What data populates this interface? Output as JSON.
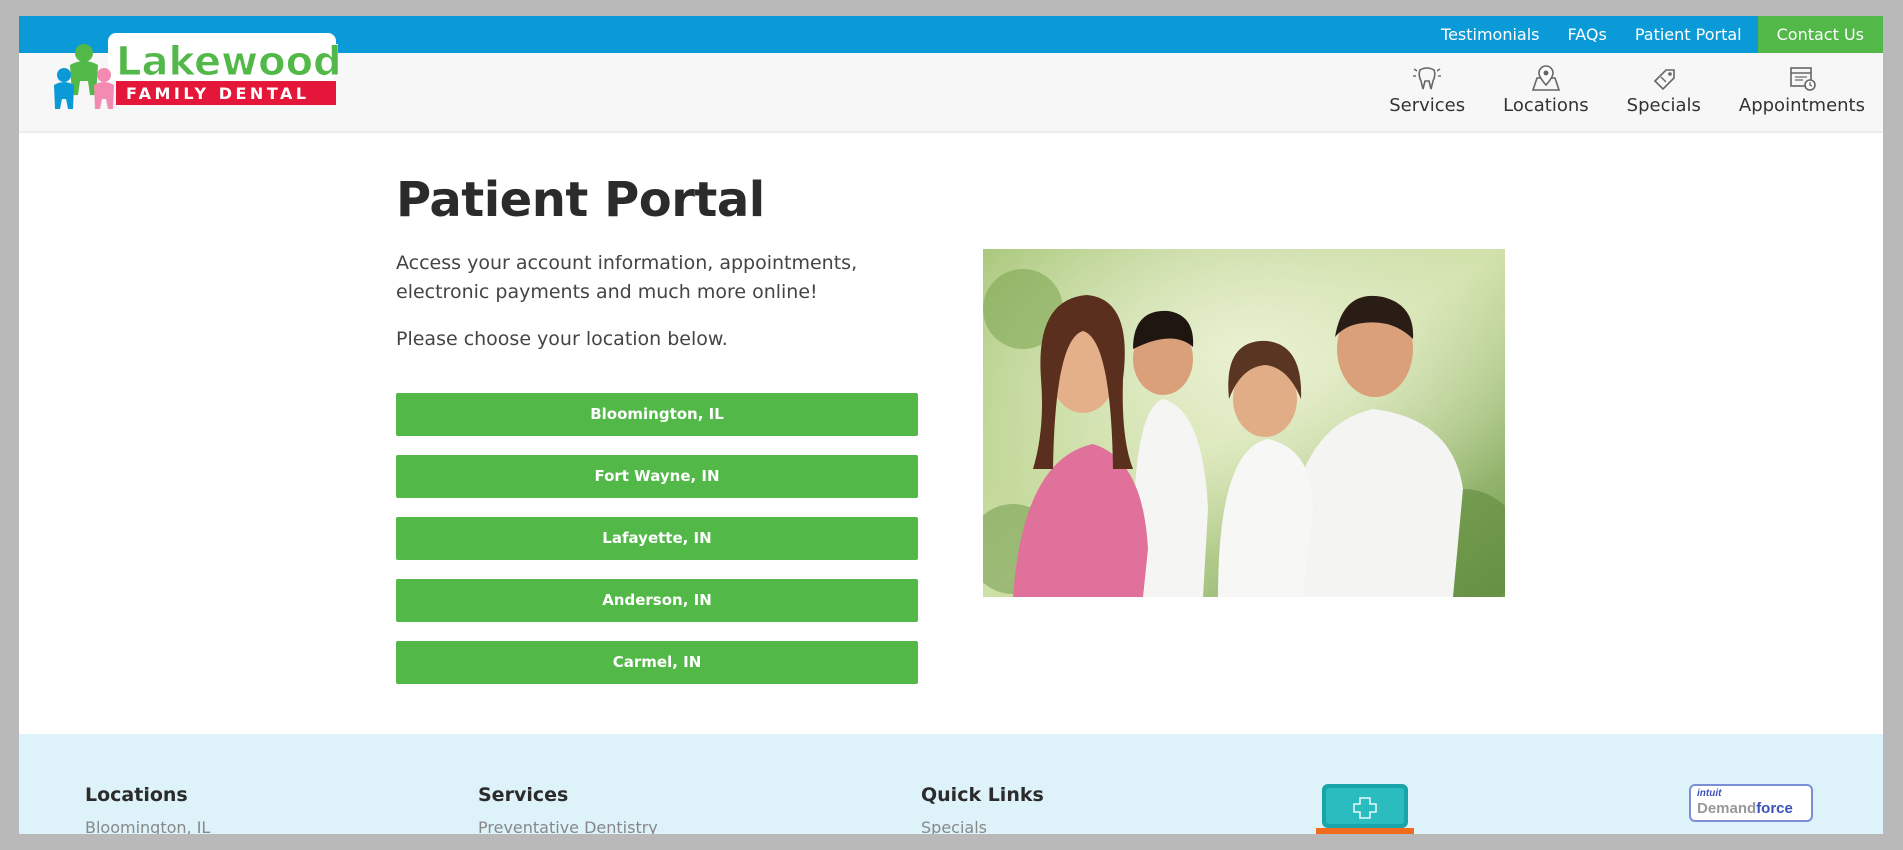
{
  "top_links": [
    {
      "label": "Testimonials"
    },
    {
      "label": "FAQs"
    },
    {
      "label": "Patient Portal"
    },
    {
      "label": "Contact Us"
    }
  ],
  "logo": {
    "name": "Lakewood",
    "tagline": "FAMILY DENTAL"
  },
  "main_nav": [
    {
      "label": "Services",
      "icon": "tooth-icon"
    },
    {
      "label": "Locations",
      "icon": "map-pin-icon"
    },
    {
      "label": "Specials",
      "icon": "tag-icon"
    },
    {
      "label": "Appointments",
      "icon": "calendar-icon"
    }
  ],
  "page": {
    "title": "Patient Portal",
    "intro": "Access your account information, appointments, electronic payments and much more online!",
    "choose": "Please choose your location below.",
    "locations": [
      "Bloomington, IL",
      "Fort Wayne, IN",
      "Lafayette, IN",
      "Anderson, IN",
      "Carmel, IN"
    ]
  },
  "footer": {
    "locations_heading": "Locations",
    "locations_first": "Bloomington, IL",
    "services_heading": "Services",
    "services_first": "Preventative Dentistry",
    "quick_heading": "Quick Links",
    "quick_first": "Specials",
    "demandforce_small": "intuit",
    "demandforce_a": "Demand",
    "demandforce_b": "force"
  },
  "colors": {
    "blue": "#0b9ad8",
    "green": "#52b848",
    "footer_bg": "#ddf2f9"
  }
}
